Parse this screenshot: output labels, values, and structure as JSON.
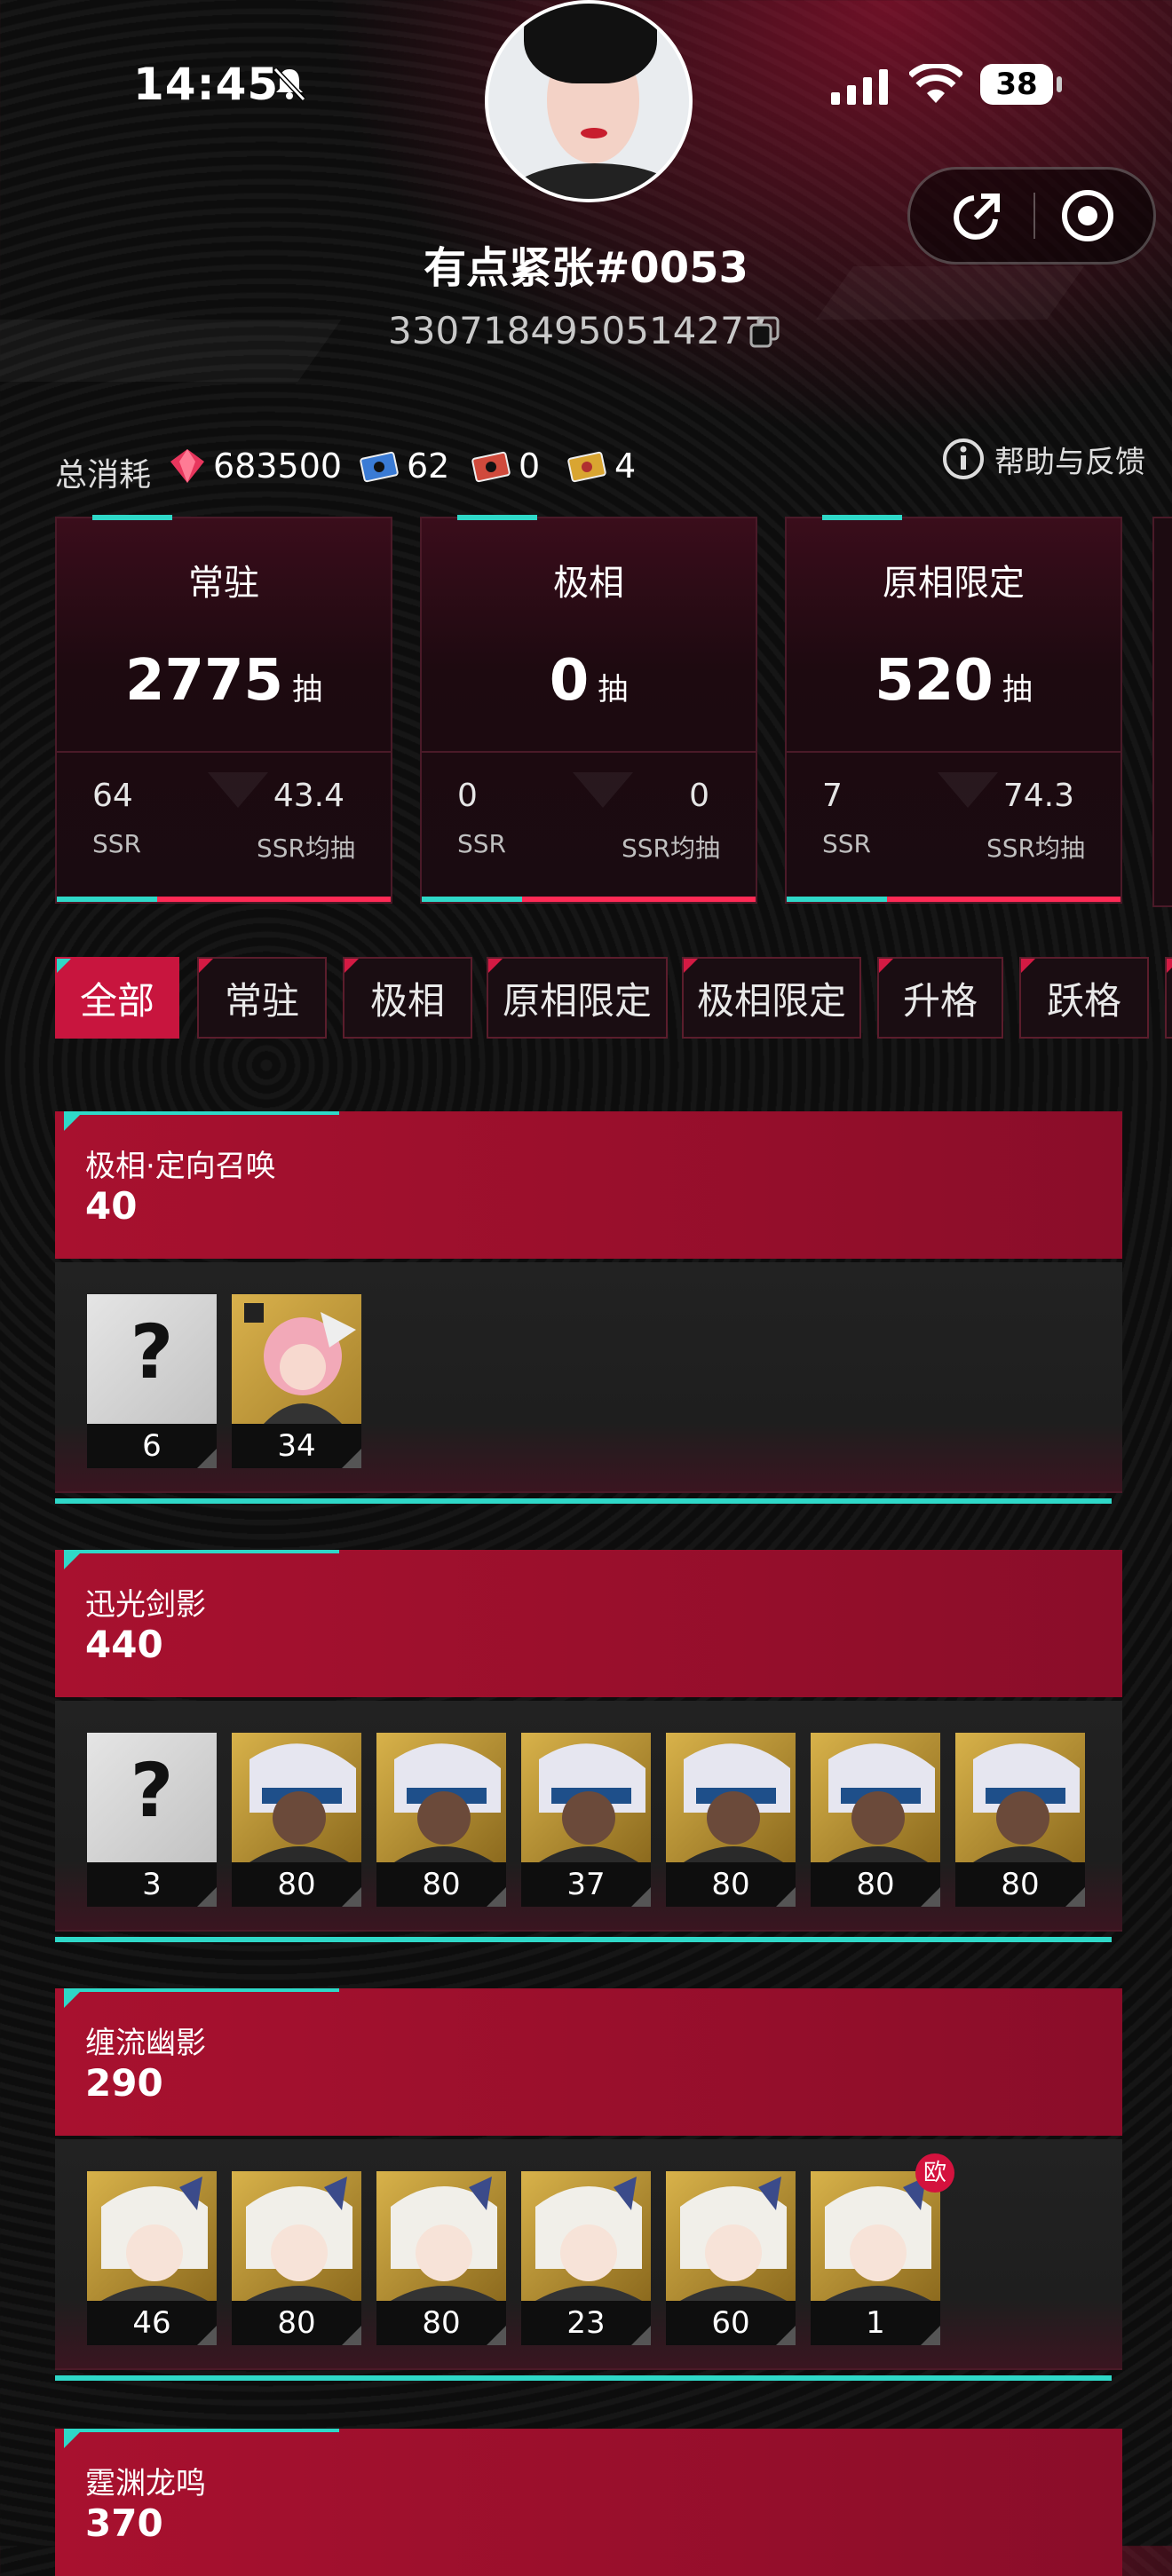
{
  "status_bar": {
    "time": "14:45",
    "battery": "38"
  },
  "profile": {
    "username": "有点紧张#0053",
    "uid": "3307184950514277"
  },
  "stats": {
    "label": "总消耗",
    "items": [
      {
        "icon": "gem-icon",
        "value": "683500",
        "color": "#e8365d"
      },
      {
        "icon": "ticket-blue-icon",
        "value": "62",
        "color": "#3a7bd5"
      },
      {
        "icon": "ticket-red-icon",
        "value": "0",
        "color": "#d04a3c"
      },
      {
        "icon": "ticket-gold-icon",
        "value": "4",
        "color": "#d9a531"
      }
    ],
    "help_label": "帮助与反馈"
  },
  "pools": [
    {
      "title": "常驻",
      "count": "2775",
      "unit": "抽",
      "ssr": "64",
      "ssr_label": "SSR",
      "avg": "43.4",
      "avg_label": "SSR均抽"
    },
    {
      "title": "极相",
      "count": "0",
      "unit": "抽",
      "ssr": "0",
      "ssr_label": "SSR",
      "avg": "0",
      "avg_label": "SSR均抽"
    },
    {
      "title": "原相限定",
      "count": "520",
      "unit": "抽",
      "ssr": "7",
      "ssr_label": "SSR",
      "avg": "74.3",
      "avg_label": "SSR均抽"
    }
  ],
  "tabs": [
    "全部",
    "常驻",
    "极相",
    "原相限定",
    "极相限定",
    "升格",
    "跃格"
  ],
  "active_tab": "全部",
  "groups": [
    {
      "name": "极相·定向召唤",
      "total": "40",
      "chars": [
        {
          "type": "unknown",
          "count": "6"
        },
        {
          "type": "pink",
          "count": "34"
        }
      ]
    },
    {
      "name": "迅光剑影",
      "total": "440",
      "chars": [
        {
          "type": "unknown",
          "count": "3"
        },
        {
          "type": "dark",
          "count": "80"
        },
        {
          "type": "dark",
          "count": "80"
        },
        {
          "type": "dark",
          "count": "37"
        },
        {
          "type": "dark",
          "count": "80"
        },
        {
          "type": "dark",
          "count": "80"
        },
        {
          "type": "dark",
          "count": "80"
        }
      ]
    },
    {
      "name": "缠流幽影",
      "total": "290",
      "chars": [
        {
          "type": "white",
          "count": "46"
        },
        {
          "type": "white",
          "count": "80"
        },
        {
          "type": "white",
          "count": "80"
        },
        {
          "type": "white",
          "count": "23"
        },
        {
          "type": "white",
          "count": "60"
        },
        {
          "type": "white",
          "count": "1",
          "badge": "欧"
        }
      ]
    },
    {
      "name": "霆渊龙鸣",
      "total": "370",
      "chars": []
    }
  ],
  "colors": {
    "accent_cyan": "#2fd8c8",
    "accent_red": "#c8153e"
  }
}
